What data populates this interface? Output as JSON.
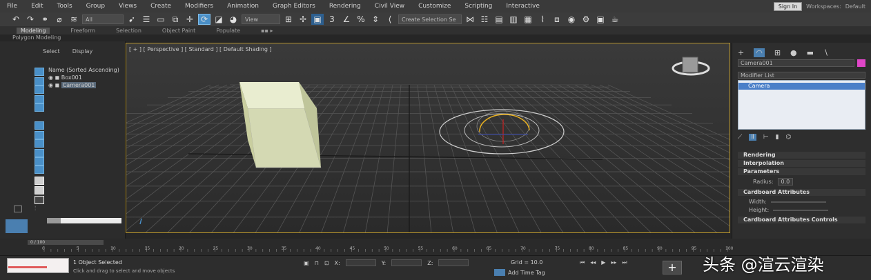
{
  "menu": {
    "items": [
      "File",
      "Edit",
      "Tools",
      "Group",
      "Views",
      "Create",
      "Modifiers",
      "Animation",
      "Graph Editors",
      "Rendering",
      "Civil View",
      "Customize",
      "Scripting",
      "Interactive"
    ],
    "workspace_label": "Workspaces:",
    "workspace_value": "Default",
    "sign_in": "Sign In"
  },
  "toolbar": {
    "filter_dropdown": "All",
    "coord_dropdown": "View",
    "selection_set": "Create Selection Se"
  },
  "ribbon": {
    "tabs": [
      "Modeling",
      "Freeform",
      "Selection",
      "Object Paint",
      "Populate"
    ],
    "mode_label": "Polygon Modeling"
  },
  "scene_explorer": {
    "tabs": [
      "Select",
      "Display"
    ],
    "tree": [
      "Name (Sorted Ascending)",
      "Box001",
      "Camera001"
    ]
  },
  "viewport": {
    "label": "[ + ] [ Perspective ] [ Standard ] [ Default Shading ]"
  },
  "command_panel": {
    "object_name": "Camera001",
    "color": "#e046c8",
    "modifier_list": "Modifier List",
    "stack_item": "Camera",
    "rollouts": [
      "Rendering",
      "Interpolation",
      "Parameters",
      "Cardboard Attributes",
      "Cardboard Attributes Controls"
    ],
    "param_label": "Radius:",
    "param_value": "0.0",
    "width_label": "Width:",
    "height_label": "Height:"
  },
  "timeline": {
    "frame_counter": "0 / 100",
    "ticks": [
      "0",
      "5",
      "10",
      "15",
      "20",
      "25",
      "30",
      "35",
      "40",
      "45",
      "50",
      "55",
      "60",
      "65",
      "70",
      "75",
      "80",
      "85",
      "90",
      "95",
      "100"
    ]
  },
  "status": {
    "maxscript": "",
    "line1": "1 Object Selected",
    "line2": "Click and drag to select and move objects",
    "x_label": "X:",
    "y_label": "Y:",
    "z_label": "Z:",
    "grid": "Grid = 10.0",
    "add_time_tag": "Add Time Tag"
  },
  "watermark": "头条 @渲云渲染"
}
